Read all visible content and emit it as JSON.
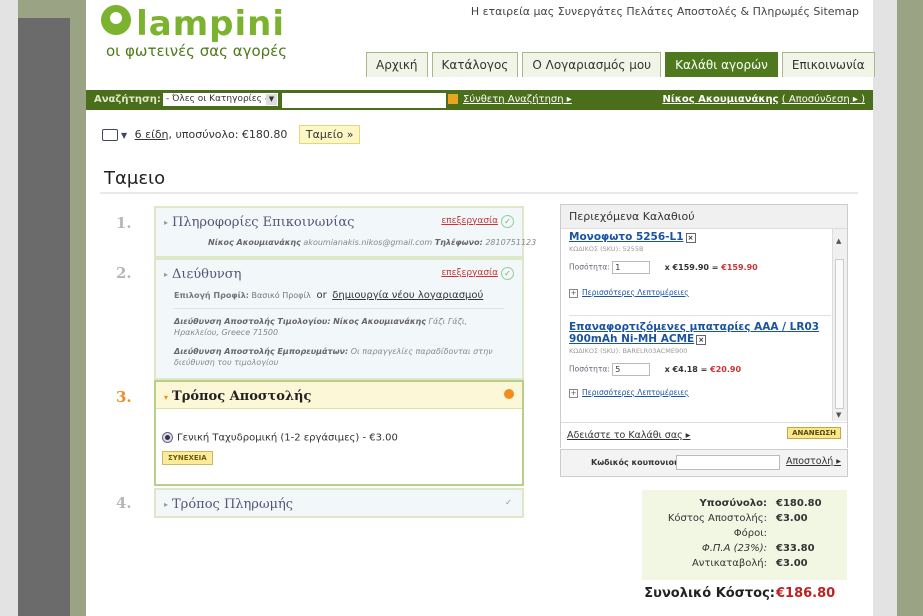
{
  "header": {
    "logo_text": "lampini",
    "tagline": "οι φωτεινές σας αγορές",
    "top_links": "Η εταιρεία μας   Συνεργάτες   Πελάτες   Αποστολές & Πληρωμές   Sitemap",
    "tabs": [
      "Αρχική",
      "Κατάλογος",
      "Ο Λογαριασμός μου",
      "Καλάθι αγορών",
      "Επικοινωνία"
    ],
    "active_tab": "Καλάθι αγορών"
  },
  "search": {
    "label": "Αναζήτηση:",
    "category": "- Όλες οι Κατηγορίες -",
    "advanced": "Σύνθετη Αναζήτηση ▸",
    "user": "Νίκος Ακουμιανάκης",
    "logout": "( Αποσύνδεση ▸ )"
  },
  "cart_summary": {
    "items": "6 είδη",
    "subtotal_text": ", υποσύνολο: €180.80",
    "checkout": "Ταμείο »"
  },
  "page_title": "Ταμειο",
  "steps": {
    "s1": {
      "num": "1.",
      "title": "Πληροφορίες Επικοινωνίας",
      "edit": "επεξεργασία",
      "name": "Νίκος Ακουμιανάκης",
      "email": "akoumianakis.nikos@gmail.com",
      "phone_label": "Τηλέφωνο:",
      "phone": "2810751123"
    },
    "s2": {
      "num": "2.",
      "title": "Διεύθυνση",
      "edit": "επεξεργασία",
      "profile_label": "Επιλογή Προφίλ:",
      "profile": "Βασικό Προφίλ",
      "or": "or",
      "new_account": "δημιουργία νέου λογαριασμού",
      "billing_label": "Διεύθυνση Αποστολής Τιμολογίου:",
      "billing_name": "Νίκος Ακουμιανάκης",
      "billing_addr": "Γάζι Γάζι, Ηρακλείου, Greece 71500",
      "goods_label": "Διεύθυνση Αποστολής Εμπορευμάτων:",
      "goods_text": "Οι παραγγελίες παραδίδονται στην διεύθυνση του τιμολογίου"
    },
    "s3": {
      "num": "3.",
      "title": "Τρόπος Αποστολής",
      "option": "Γενική Ταχυδρομική (1-2 εργάσιμες) - €3.00",
      "continue": "ΣΥΝΕΧΕΙΑ"
    },
    "s4": {
      "num": "4.",
      "title": "Τρόπος Πληρωμής"
    }
  },
  "cart_panel": {
    "title": "Περιεχόμενα Καλαθιού",
    "items": [
      {
        "name": "Μονοφωτο 5256-L1",
        "sku": "ΚΩΔΙΚΟΣ (SKU): 5255B",
        "qty_label": "Ποσότητα:",
        "qty": "1",
        "unit": "x €159.90 =",
        "total": "€159.90",
        "more": "Περισσότερες Λεπτομέρειες"
      },
      {
        "name": "Επαναφορτιζόμενες μπαταρίες AAA / LR03 900mAh Ni-MH ACME",
        "sku": "ΚΩΔΙΚΟΣ (SKU): BARELR03ACME900",
        "qty_label": "Ποσότητα:",
        "qty": "5",
        "unit": "x €4.18 =",
        "total": "€20.90",
        "more": "Περισσότερες Λεπτομέρειες"
      }
    ],
    "empty_cart": "Αδειάστε το Καλάθι σας ▸",
    "update": "ΑΝΑΝΕΩΣΗ"
  },
  "coupon": {
    "label": "Κωδικός κουπονιού:",
    "send": "Αποστολή ▸"
  },
  "totals": {
    "subtotal_label": "Υποσύνολο:",
    "subtotal": "€180.80",
    "shipping_label": "Κόστος Αποστολής:",
    "shipping": "€3.00",
    "taxes_label": "Φόροι:",
    "vat_label": "Φ.Π.Α (23%):",
    "vat": "€33.80",
    "cod_label": "Αντικαταβολή:",
    "cod": "€3.00",
    "grand_label": "Συνολικό Κόστος:",
    "grand": "€186.80"
  }
}
